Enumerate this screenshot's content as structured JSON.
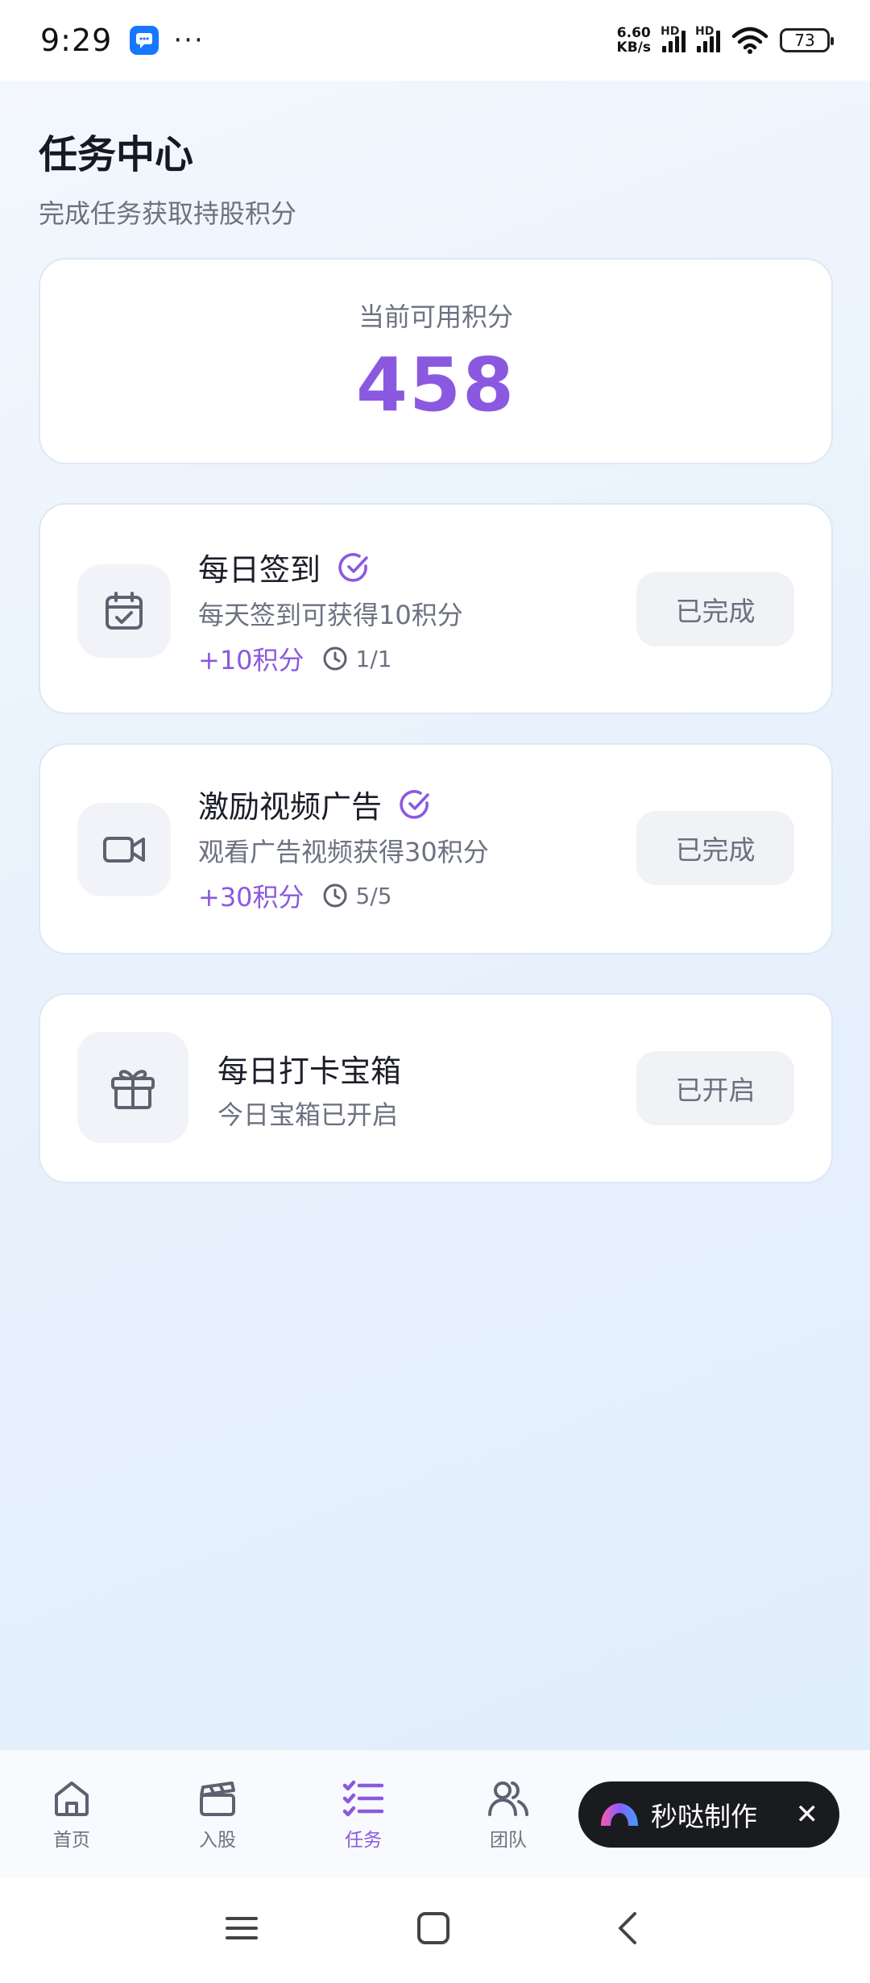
{
  "status_bar": {
    "time": "9:29",
    "net_speed_value": "6.60",
    "net_speed_unit": "KB/s",
    "hd_label": "HD",
    "battery": "73"
  },
  "header": {
    "title": "任务中心",
    "subtitle": "完成任务获取持股积分"
  },
  "points": {
    "label": "当前可用积分",
    "value": "458"
  },
  "tasks": [
    {
      "title": "每日签到",
      "description": "每天签到可获得10积分",
      "reward": "+10积分",
      "progress": "1/1",
      "status": "已完成",
      "icon": "calendar-check-icon"
    },
    {
      "title": "激励视频广告",
      "description": "观看广告视频获得30积分",
      "reward": "+30积分",
      "progress": "5/5",
      "status": "已完成",
      "icon": "video-camera-icon"
    },
    {
      "title": "每日打卡宝箱",
      "description": "今日宝箱已开启",
      "status": "已开启",
      "icon": "gift-icon"
    }
  ],
  "bottom_nav": {
    "items": [
      {
        "label": "首页",
        "icon": "home-icon"
      },
      {
        "label": "入股",
        "icon": "clapperboard-icon"
      },
      {
        "label": "任务",
        "icon": "task-list-icon",
        "active": true
      },
      {
        "label": "团队",
        "icon": "team-icon"
      }
    ]
  },
  "maker_badge": {
    "label": "秒哒制作",
    "close": "✕"
  },
  "colors": {
    "accent": "#8b59e0",
    "button_bg": "#f0f2f6",
    "text_secondary": "#6d7280"
  }
}
